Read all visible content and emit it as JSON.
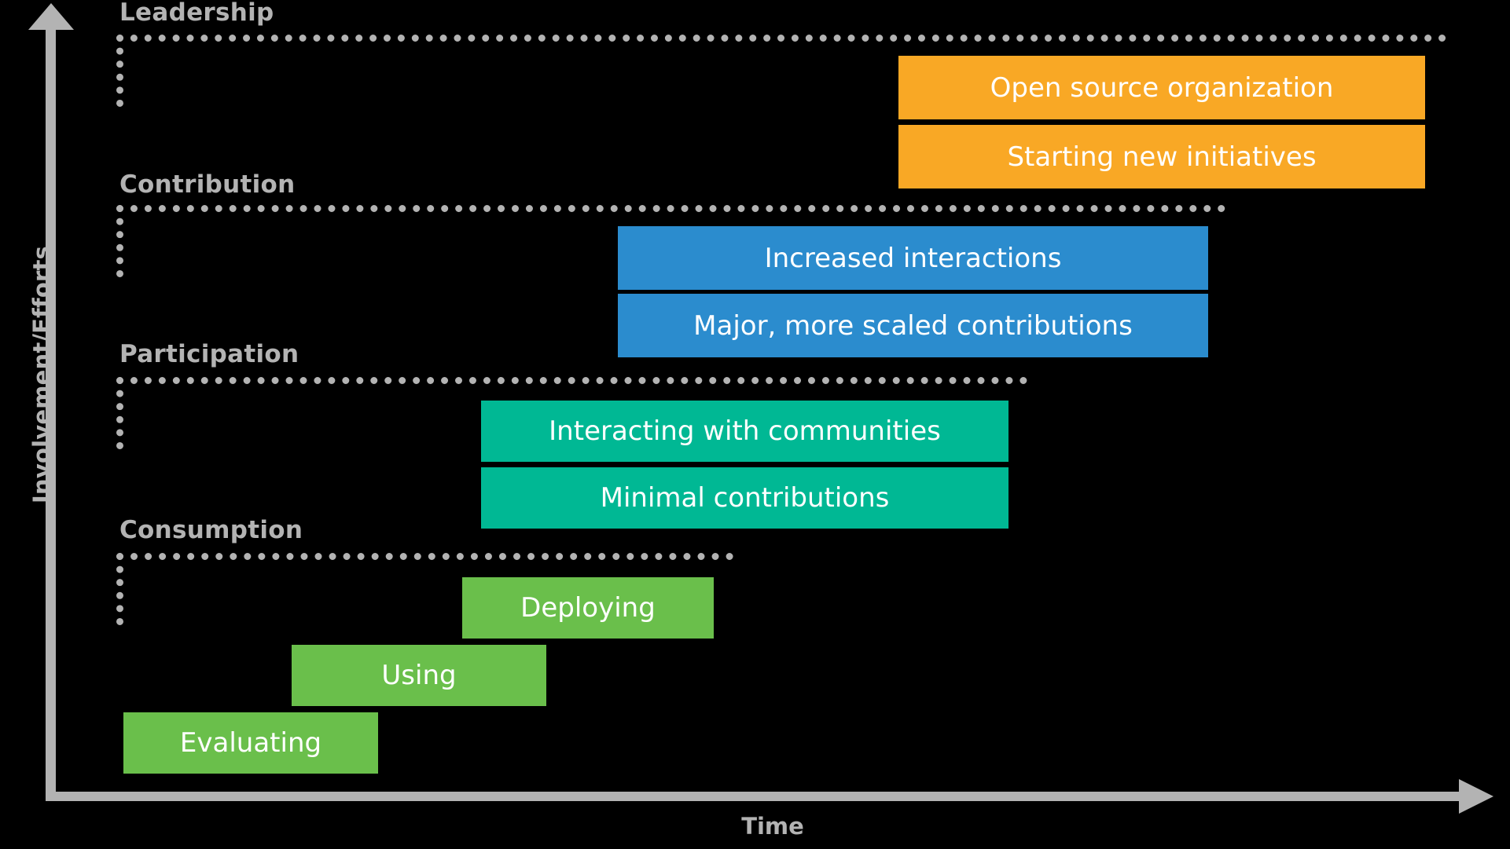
{
  "diagram": {
    "axis": {
      "y_label": "Involvement/Efforts",
      "x_label": "Time"
    },
    "stages": [
      {
        "id": "leadership",
        "label": "Leadership"
      },
      {
        "id": "contribution",
        "label": "Contribution"
      },
      {
        "id": "participation",
        "label": "Participation"
      },
      {
        "id": "consumption",
        "label": "Consumption"
      }
    ],
    "bars": [
      {
        "id": "open-source-organization",
        "label": "Open source organization",
        "stage": "leadership",
        "color": "#F9A825"
      },
      {
        "id": "starting-new-initiatives",
        "label": "Starting new initiatives",
        "stage": "leadership",
        "color": "#F9A825"
      },
      {
        "id": "increased-interactions",
        "label": "Increased interactions",
        "stage": "contribution",
        "color": "#2B8CCE"
      },
      {
        "id": "major-more-scaled-contributions",
        "label": "Major, more scaled contributions",
        "stage": "contribution",
        "color": "#2B8CCE"
      },
      {
        "id": "interacting-with-communities",
        "label": "Interacting with communities",
        "stage": "participation",
        "color": "#00B894"
      },
      {
        "id": "minimal-contributions",
        "label": "Minimal contributions",
        "stage": "participation",
        "color": "#00B894"
      },
      {
        "id": "deploying",
        "label": "Deploying",
        "stage": "consumption",
        "color": "#6ABF4B"
      },
      {
        "id": "using",
        "label": "Using",
        "stage": "consumption",
        "color": "#6ABF4B"
      },
      {
        "id": "evaluating",
        "label": "Evaluating",
        "stage": "consumption",
        "color": "#6ABF4B"
      }
    ],
    "colors": {
      "background": "#000000",
      "axis": "#b3b3b3",
      "stage_outline": "#b3b3b3",
      "leadership": "#F9A825",
      "contribution": "#2B8CCE",
      "participation": "#00B894",
      "consumption": "#6ABF4B",
      "bar_text": "#ffffff"
    }
  },
  "chart_data": {
    "type": "bar",
    "title": "",
    "xlabel": "Time",
    "ylabel": "Involvement/Efforts",
    "grid": false,
    "legend": "none",
    "note": "Horizontal staircase (Gantt-like) chart of open source engagement maturity: each band is a stage, each bar an activity spanning a period of time; bars shift rightward and upward with increasing involvement.",
    "bands": [
      "Consumption",
      "Participation",
      "Contribution",
      "Leadership"
    ],
    "series": [
      {
        "name": "Evaluating",
        "band": "Consumption",
        "start": 0.05,
        "end": 0.2,
        "color": "#6ABF4B"
      },
      {
        "name": "Using",
        "band": "Consumption",
        "start": 0.15,
        "end": 0.29,
        "color": "#6ABF4B"
      },
      {
        "name": "Deploying",
        "band": "Consumption",
        "start": 0.21,
        "end": 0.35,
        "color": "#6ABF4B"
      },
      {
        "name": "Minimal contributions",
        "band": "Participation",
        "start": 0.3,
        "end": 0.68,
        "color": "#00B894"
      },
      {
        "name": "Interacting with communities",
        "band": "Participation",
        "start": 0.3,
        "end": 0.68,
        "color": "#00B894"
      },
      {
        "name": "Major, more scaled contributions",
        "band": "Contribution",
        "start": 0.4,
        "end": 0.82,
        "color": "#2B8CCE"
      },
      {
        "name": "Increased interactions",
        "band": "Contribution",
        "start": 0.4,
        "end": 0.82,
        "color": "#2B8CCE"
      },
      {
        "name": "Starting new initiatives",
        "band": "Leadership",
        "start": 0.6,
        "end": 0.97,
        "color": "#F9A825"
      },
      {
        "name": "Open source organization",
        "band": "Leadership",
        "start": 0.6,
        "end": 0.97,
        "color": "#F9A825"
      }
    ]
  }
}
